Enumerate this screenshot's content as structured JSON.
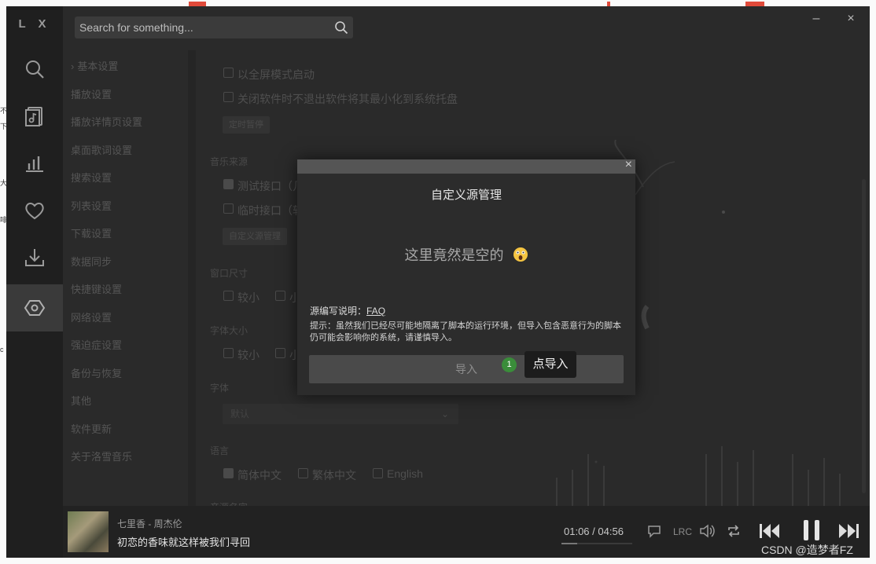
{
  "app": {
    "logo": "L X"
  },
  "search": {
    "placeholder": "Search for something..."
  },
  "window_controls": {
    "minimize": "–",
    "close": "×"
  },
  "nav": [
    {
      "name": "search",
      "icon": "search-icon",
      "active": false
    },
    {
      "name": "song-list",
      "icon": "music-file-icon",
      "active": false
    },
    {
      "name": "leaderboard",
      "icon": "bar-chart-icon",
      "active": false
    },
    {
      "name": "favorites",
      "icon": "heart-icon",
      "active": false
    },
    {
      "name": "download",
      "icon": "download-icon",
      "active": false
    },
    {
      "name": "settings",
      "icon": "settings-hex-icon",
      "active": true
    }
  ],
  "settings_menu": {
    "items": [
      "基本设置",
      "播放设置",
      "播放详情页设置",
      "桌面歌词设置",
      "搜索设置",
      "列表设置",
      "下载设置",
      "数据同步",
      "快捷键设置",
      "网络设置",
      "强迫症设置",
      "备份与恢复",
      "其他",
      "软件更新",
      "关于洛雪音乐"
    ],
    "expanded_caret": "›"
  },
  "settings_content": {
    "fullscreen_start": "以全屏模式启动",
    "minimize_to_tray": "关闭软件时不退出软件将其最小化到系统托盘",
    "timer_pause_button": "定时暂停",
    "music_source_label": "音乐来源",
    "source_test": "测试接口（几",
    "source_temp": "临时接口（软",
    "custom_source_button": "自定义源管理",
    "window_size_label": "窗口尺寸",
    "window_size_opt1": "较小",
    "window_size_opt2": "小",
    "font_size_label": "字体大小",
    "font_size_opt1": "较小",
    "font_size_opt2": "小",
    "font_label": "字体",
    "font_value": "默认",
    "language_label": "语言",
    "lang_simplified": "简体中文",
    "lang_traditional": "繁体中文",
    "lang_english": "English",
    "source_name_label": "音源名字"
  },
  "modal": {
    "title": "自定义源管理",
    "close": "×",
    "empty_text": "这里竟然是空的",
    "doc_prefix": "源编写说明：",
    "doc_link": "FAQ",
    "tip": "提示：虽然我们已经尽可能地隔离了脚本的运行环境，但导入包含恶意行为的脚本仍可能会影响你的系统，请谨慎导入。",
    "import_button": "导入"
  },
  "annotation": {
    "step": "1",
    "label": "点导入"
  },
  "player": {
    "song": "七里香 - 周杰伦",
    "lyric": "初恋的香味就这样被我们寻回",
    "current_time": "01:06",
    "separator": "/",
    "total_time": "04:56",
    "progress": 0.223,
    "lrc": "LRC",
    "icons": [
      "comment-icon",
      "lrc",
      "volume-icon",
      "repeat-icon",
      "prev-icon",
      "pause-icon",
      "next-icon"
    ]
  },
  "watermark": "CSDN @造梦者FZ",
  "desktop": {
    "left_fragments": [
      "不",
      "下",
      "大",
      "啡",
      "c"
    ]
  },
  "colors": {
    "accent_green": "#3a8d3a",
    "window_bg": "#2a2a2a",
    "nav_bg": "#1f1f1f"
  }
}
